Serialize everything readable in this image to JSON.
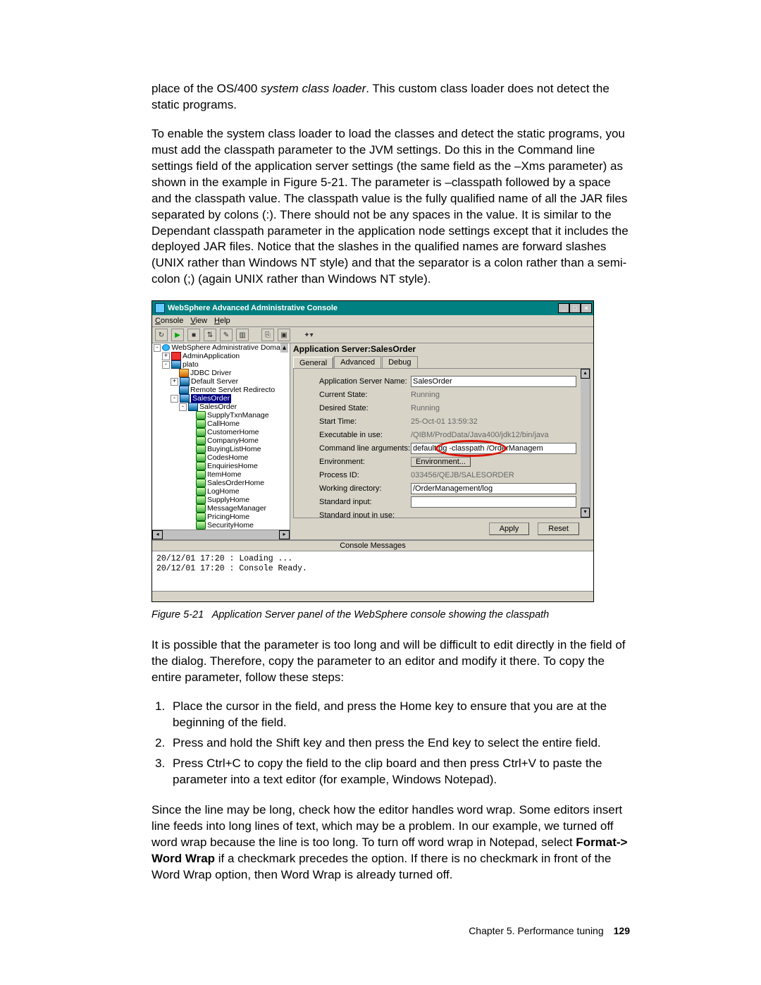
{
  "para1_a": "place of the OS/400 ",
  "para1_b": "system class loader",
  "para1_c": ". This custom class loader does not detect the static programs.",
  "para2": "To enable the system class loader to load the classes and detect the static programs, you must add the classpath parameter to the JVM settings. Do this in the Command line settings field of the application server settings (the same field as the –Xms parameter) as shown in the example in Figure 5-21. The parameter is –classpath followed by a space and the classpath value. The classpath value is the fully qualified name of all the JAR files separated by colons (:). There should not be any spaces in the value. It is similar to the Dependant classpath parameter in the application node settings except that it includes the deployed JAR files. Notice that the slashes in the qualified names are forward slashes (UNIX rather than Windows NT style) and that the separator is a colon rather than a semi-colon (;) (again UNIX rather than Windows NT style).",
  "win_title": "WebSphere Advanced Administrative Console",
  "menus": {
    "console": "Console",
    "view": "View",
    "help": "Help"
  },
  "tree": {
    "root": "WebSphere Administrative Doma",
    "n1": "AdminApplication",
    "n2": "plato",
    "n3": "JDBC Driver",
    "n4": "Default Server",
    "n5": "Remote Servlet Redirecto",
    "n6": "SalesOrder",
    "n7": "SalesOrder",
    "beans": [
      "SupplyTxnManage",
      "CallHome",
      "CustomerHome",
      "CompanyHome",
      "BuyingListHome",
      "CodesHome",
      "EnquiriesHome",
      "ItemHome",
      "SalesOrderHome",
      "LogHome",
      "SupplyHome",
      "MessageManager",
      "PricingHome",
      "SecurityHome"
    ]
  },
  "panel_title": "Application Server:SalesOrder",
  "tabs": {
    "general": "General",
    "advanced": "Advanced",
    "debug": "Debug"
  },
  "fields": {
    "app_name_l": "Application Server Name:",
    "app_name_v": "SalesOrder",
    "cur_state_l": "Current State:",
    "cur_state_v": "Running",
    "des_state_l": "Desired State:",
    "des_state_v": "Running",
    "start_l": "Start Time:",
    "start_v": "25-Oct-01 13:59:32",
    "exec_l": "Executable in use:",
    "exec_v": "/QIBM/ProdData/Java400/jdk12/bin/java",
    "cmd_l": "Command line arguments:",
    "cmd_v": "default.dg -classpath /OrderManagem",
    "env_l": "Environment:",
    "env_btn": "Environment...",
    "pid_l": "Process ID:",
    "pid_v": "033456/QEJB/SALESORDER",
    "wd_l": "Working directory:",
    "wd_v": "/OrderManagement/log",
    "stdin_l": "Standard input:",
    "stdin_v": "",
    "stdinuse_l": "Standard input in use:"
  },
  "buttons": {
    "apply": "Apply",
    "reset": "Reset"
  },
  "msg_header": "Console Messages",
  "console_lines": "20/12/01 17:20 : Loading ...\n20/12/01 17:20 : Console Ready.",
  "caption": "Figure 5-21   Application Server panel of the WebSphere console showing the classpath",
  "para3": "It is possible that the parameter is too long and will be difficult to edit directly in the field of the dialog. Therefore, copy the parameter to an editor and modify it there. To copy the entire parameter, follow these steps:",
  "steps": [
    "Place the cursor in the field, and press the Home key to ensure that you are at the beginning of the field.",
    "Press and hold the Shift key and then press the End key to select the entire field.",
    "Press Ctrl+C to copy the field to the clip board and then press Ctrl+V to paste the parameter into a text editor (for example, Windows Notepad)."
  ],
  "para4_a": "Since the line may be long, check how the editor handles word wrap. Some editors insert line feeds into long lines of text, which may be a problem. In our example, we turned off word wrap because the line is too long. To turn off word wrap in Notepad, select ",
  "para4_b": "Format-> Word Wrap",
  "para4_c": " if a checkmark precedes the option. If there is no checkmark in front of the Word Wrap option, then Word Wrap is already turned off.",
  "footer_chapter": "Chapter 5. Performance tuning",
  "footer_page": "129"
}
